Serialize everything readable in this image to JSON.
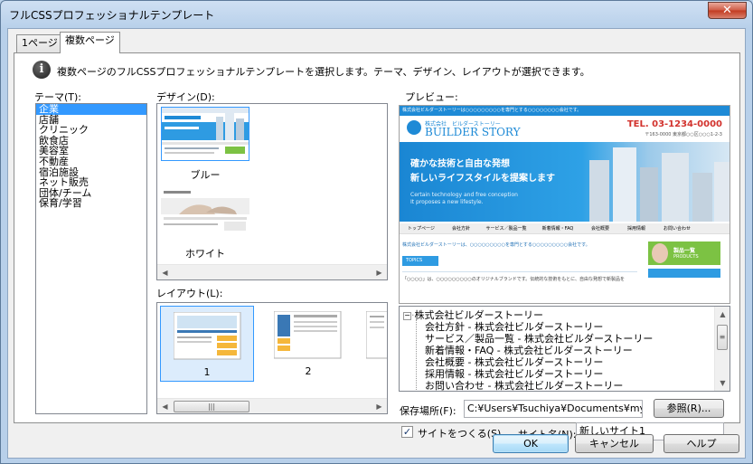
{
  "window": {
    "title": "フルCSSプロフェッショナルテンプレート",
    "close_glyph": "✕"
  },
  "tabs": [
    {
      "label": "1ページ"
    },
    {
      "label": "複数ページ"
    }
  ],
  "info": {
    "icon_glyph": "i",
    "text": "複数ページのフルCSSプロフェッショナルテンプレートを選択します。テーマ、デザイン、レイアウトが選択できます。"
  },
  "labels": {
    "theme": "テーマ(T):",
    "design": "デザイン(D):",
    "layout": "レイアウト(L):",
    "preview": "プレビュー:",
    "save_location": "保存場所(F):",
    "site_name": "サイト名(N):",
    "create_site": "サイトをつくる(S)"
  },
  "themes": [
    "企業",
    "店舗",
    "クリニック",
    "飲食店",
    "美容室",
    "不動産",
    "宿泊施設",
    "ネット販売",
    "団体/チーム",
    "保育/学習"
  ],
  "designs": [
    {
      "label": "ブルー"
    },
    {
      "label": "ホワイト"
    }
  ],
  "layouts": [
    {
      "label": "1"
    },
    {
      "label": "2"
    }
  ],
  "preview": {
    "top_strip": "株式会社ビルダーストーリーは○○○○○○○○○を専門とする○○○○○○○○会社です。",
    "company_small": "株式会社　ビルダーストーリー",
    "brand": "BUILDER STORY",
    "tel": "TEL. 03-1234-0000",
    "address": "〒163-0000 東京都○○区○○○1-2-3",
    "hero_line1": "確かな技術と自由な発想",
    "hero_line2": "新しいライフスタイルを提案します",
    "hero_en1": "Certain technology and free conception",
    "hero_en2": "It proposes a new lifestyle.",
    "nav": [
      "トップページ",
      "会社方針",
      "サービス／製品一覧",
      "新着情報・FAQ",
      "会社概要",
      "採用情報",
      "お問い合わせ"
    ],
    "intro": "株式会社ビルダーストーリーは、○○○○○○○○○を専門とする○○○○○○○○○会社です。",
    "topics": "TOPICS",
    "body_text": "「○○○○」は、○○○○○○○○○のオリジナルブランドです。伝統的な技術をもとに、自由な発想で新製品を",
    "side_banner": "製品一覧",
    "side_banner_en": "PRODUCTS"
  },
  "tree": {
    "root": "株式会社ビルダーストーリー",
    "children": [
      "会社方針 - 株式会社ビルダーストーリー",
      "サービス／製品一覧 - 株式会社ビルダーストーリー",
      "新着情報・FAQ - 株式会社ビルダーストーリー",
      "会社概要 - 株式会社ビルダーストーリー",
      "採用情報 - 株式会社ビルダーストーリー",
      "お問い合わせ - 株式会社ビルダーストーリー"
    ]
  },
  "fields": {
    "save_location_value": "C:¥Users¥Tsuchiya¥Documents¥mysite",
    "site_name_value": "新しいサイト1",
    "create_site_checked": "✓"
  },
  "buttons": {
    "browse": "参照(R)...",
    "ok": "OK",
    "cancel": "キャンセル",
    "help": "ヘルプ"
  },
  "colors": {
    "accent": "#3399ff",
    "preview_blue": "#1e8ad6",
    "tel_red": "#d2322d"
  }
}
